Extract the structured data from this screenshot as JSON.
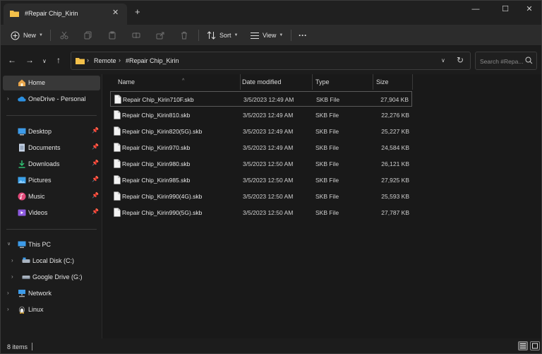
{
  "window": {
    "tab_title": "#Repair Chip_Kirin",
    "tab_close": "✕",
    "new_tab": "+",
    "minimize": "—",
    "maximize": "☐",
    "close": "✕"
  },
  "toolbar": {
    "new_label": "New",
    "sort_label": "Sort",
    "view_label": "View",
    "more_label": "···"
  },
  "address": {
    "crumbs": [
      "Remote",
      "#Repair Chip_Kirin"
    ],
    "search_placeholder": "Search #Repa..."
  },
  "sidebar": {
    "items": [
      {
        "label": "Home",
        "icon": "home-icon"
      },
      {
        "label": "OneDrive - Personal",
        "icon": "cloud-icon"
      },
      {
        "label": "Desktop",
        "icon": "desktop-icon"
      },
      {
        "label": "Documents",
        "icon": "documents-icon"
      },
      {
        "label": "Downloads",
        "icon": "download-icon"
      },
      {
        "label": "Pictures",
        "icon": "pictures-icon"
      },
      {
        "label": "Music",
        "icon": "music-icon"
      },
      {
        "label": "Videos",
        "icon": "videos-icon"
      },
      {
        "label": "This PC",
        "icon": "pc-icon"
      },
      {
        "label": "Local Disk (C:)",
        "icon": "drive-icon"
      },
      {
        "label": "Google Drive (G:)",
        "icon": "drive-icon"
      },
      {
        "label": "Network",
        "icon": "network-icon"
      },
      {
        "label": "Linux",
        "icon": "linux-icon"
      }
    ]
  },
  "columns": {
    "name": "Name",
    "date": "Date modified",
    "type": "Type",
    "size": "Size"
  },
  "files": [
    {
      "name": "Repair Chip_Kirin710F.skb",
      "date": "3/5/2023 12:49 AM",
      "type": "SKB File",
      "size": "27,904 KB"
    },
    {
      "name": "Repair Chip_Kirin810.skb",
      "date": "3/5/2023 12:49 AM",
      "type": "SKB File",
      "size": "22,276 KB"
    },
    {
      "name": "Repair Chip_Kirin820(5G).skb",
      "date": "3/5/2023 12:49 AM",
      "type": "SKB File",
      "size": "25,227 KB"
    },
    {
      "name": "Repair Chip_Kirin970.skb",
      "date": "3/5/2023 12:49 AM",
      "type": "SKB File",
      "size": "24,584 KB"
    },
    {
      "name": "Repair Chip_Kirin980.skb",
      "date": "3/5/2023 12:50 AM",
      "type": "SKB File",
      "size": "26,121 KB"
    },
    {
      "name": "Repair Chip_Kirin985.skb",
      "date": "3/5/2023 12:50 AM",
      "type": "SKB File",
      "size": "27,925 KB"
    },
    {
      "name": "Repair Chip_Kirin990(4G).skb",
      "date": "3/5/2023 12:50 AM",
      "type": "SKB File",
      "size": "25,593 KB"
    },
    {
      "name": "Repair Chip_Kirin990(5G).skb",
      "date": "3/5/2023 12:50 AM",
      "type": "SKB File",
      "size": "27,787 KB"
    }
  ],
  "status": {
    "count": "8 items"
  },
  "colors": {
    "folder": "#f3c04a",
    "onedrive": "#2b8fe0",
    "accent": "#60cdff"
  }
}
